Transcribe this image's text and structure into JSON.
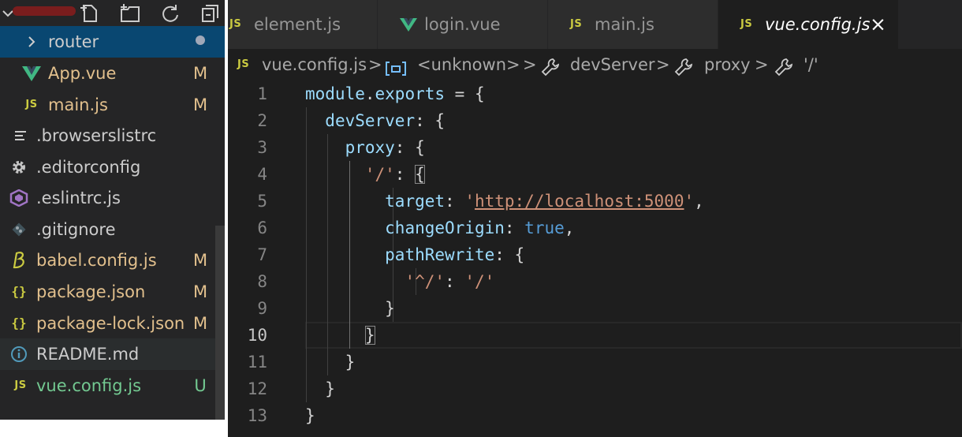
{
  "explorer": {
    "items": [
      {
        "label": "router",
        "status": "",
        "kind": "folder",
        "color": "#cccccc"
      },
      {
        "label": "App.vue",
        "status": "M",
        "kind": "vue",
        "color": "#e2c08d"
      },
      {
        "label": "main.js",
        "status": "M",
        "kind": "js",
        "icon_text": "JS",
        "color": "#e2c08d"
      },
      {
        "label": ".browserslistrc",
        "status": "",
        "kind": "lines",
        "color": "#cccccc"
      },
      {
        "label": ".editorconfig",
        "status": "",
        "kind": "gear",
        "color": "#cccccc"
      },
      {
        "label": ".eslintrc.js",
        "status": "",
        "kind": "eslint",
        "color": "#cccccc"
      },
      {
        "label": ".gitignore",
        "status": "",
        "kind": "git",
        "color": "#cccccc"
      },
      {
        "label": "babel.config.js",
        "status": "M",
        "kind": "babel",
        "color": "#e2c08d"
      },
      {
        "label": "package.json",
        "status": "M",
        "kind": "json",
        "icon_text": "{}",
        "color": "#e2c08d"
      },
      {
        "label": "package-lock.json",
        "status": "M",
        "kind": "json",
        "icon_text": "{}",
        "color": "#e2c08d"
      },
      {
        "label": "README.md",
        "status": "",
        "kind": "info",
        "color": "#cccccc"
      },
      {
        "label": "vue.config.js",
        "status": "U",
        "kind": "js",
        "icon_text": "JS",
        "color": "#73c991"
      }
    ]
  },
  "tabs": [
    {
      "label": "element.js",
      "icon_text": "JS"
    },
    {
      "label": "login.vue"
    },
    {
      "label": "main.js",
      "icon_text": "JS"
    },
    {
      "label": "vue.config.js",
      "icon_text": "JS",
      "active": true,
      "close": "×"
    }
  ],
  "breadcrumb": {
    "file": "vue.config.js",
    "file_icon_text": "JS",
    "sep": ">",
    "items": [
      "<unknown>",
      "devServer",
      "proxy",
      "'/'"
    ]
  },
  "code": {
    "lines": [
      {
        "n": "1",
        "tokens": [
          [
            "k-var",
            "module"
          ],
          [
            "k-punc",
            "."
          ],
          [
            "k-var",
            "exports"
          ],
          [
            "k-punc",
            " = {"
          ]
        ]
      },
      {
        "n": "2",
        "tokens": [
          [
            "k-punc",
            "  "
          ],
          [
            "k-var",
            "devServer"
          ],
          [
            "k-punc",
            ": {"
          ]
        ]
      },
      {
        "n": "3",
        "tokens": [
          [
            "k-punc",
            "    "
          ],
          [
            "k-var",
            "proxy"
          ],
          [
            "k-punc",
            ": {"
          ]
        ]
      },
      {
        "n": "4",
        "tokens": [
          [
            "k-punc",
            "      "
          ],
          [
            "k-str",
            "'/'"
          ],
          [
            "k-punc",
            ": "
          ],
          [
            "bracket",
            "{"
          ]
        ]
      },
      {
        "n": "5",
        "tokens": [
          [
            "k-punc",
            "        "
          ],
          [
            "k-var",
            "target"
          ],
          [
            "k-punc",
            ": "
          ],
          [
            "k-str",
            "'"
          ],
          [
            "k-url",
            "http://localhost:5000"
          ],
          [
            "k-str",
            "'"
          ],
          [
            "k-punc",
            ","
          ]
        ]
      },
      {
        "n": "6",
        "tokens": [
          [
            "k-punc",
            "        "
          ],
          [
            "k-var",
            "changeOrigin"
          ],
          [
            "k-punc",
            ": "
          ],
          [
            "k-kw",
            "true"
          ],
          [
            "k-punc",
            ","
          ]
        ]
      },
      {
        "n": "7",
        "tokens": [
          [
            "k-punc",
            "        "
          ],
          [
            "k-var",
            "pathRewrite"
          ],
          [
            "k-punc",
            ": {"
          ]
        ]
      },
      {
        "n": "8",
        "tokens": [
          [
            "k-punc",
            "          "
          ],
          [
            "k-str",
            "'^/'"
          ],
          [
            "k-punc",
            ": "
          ],
          [
            "k-str",
            "'/'"
          ]
        ]
      },
      {
        "n": "9",
        "tokens": [
          [
            "k-punc",
            "        }"
          ]
        ]
      },
      {
        "n": "10",
        "tokens": [
          [
            "k-punc",
            "      "
          ],
          [
            "bracket",
            "}"
          ]
        ]
      },
      {
        "n": "11",
        "tokens": [
          [
            "k-punc",
            "    }"
          ]
        ]
      },
      {
        "n": "12",
        "tokens": [
          [
            "k-punc",
            "  }"
          ]
        ]
      },
      {
        "n": "13",
        "tokens": [
          [
            "k-punc",
            "}"
          ]
        ]
      }
    ]
  },
  "colors": {
    "sidebar_bg": "#252526",
    "selected_row": "#094771",
    "hover_row": "#2a2d2e",
    "modified": "#e2c08d",
    "untracked": "#73c991",
    "js_badge": "#cbcb41",
    "vue": "#41b883"
  }
}
